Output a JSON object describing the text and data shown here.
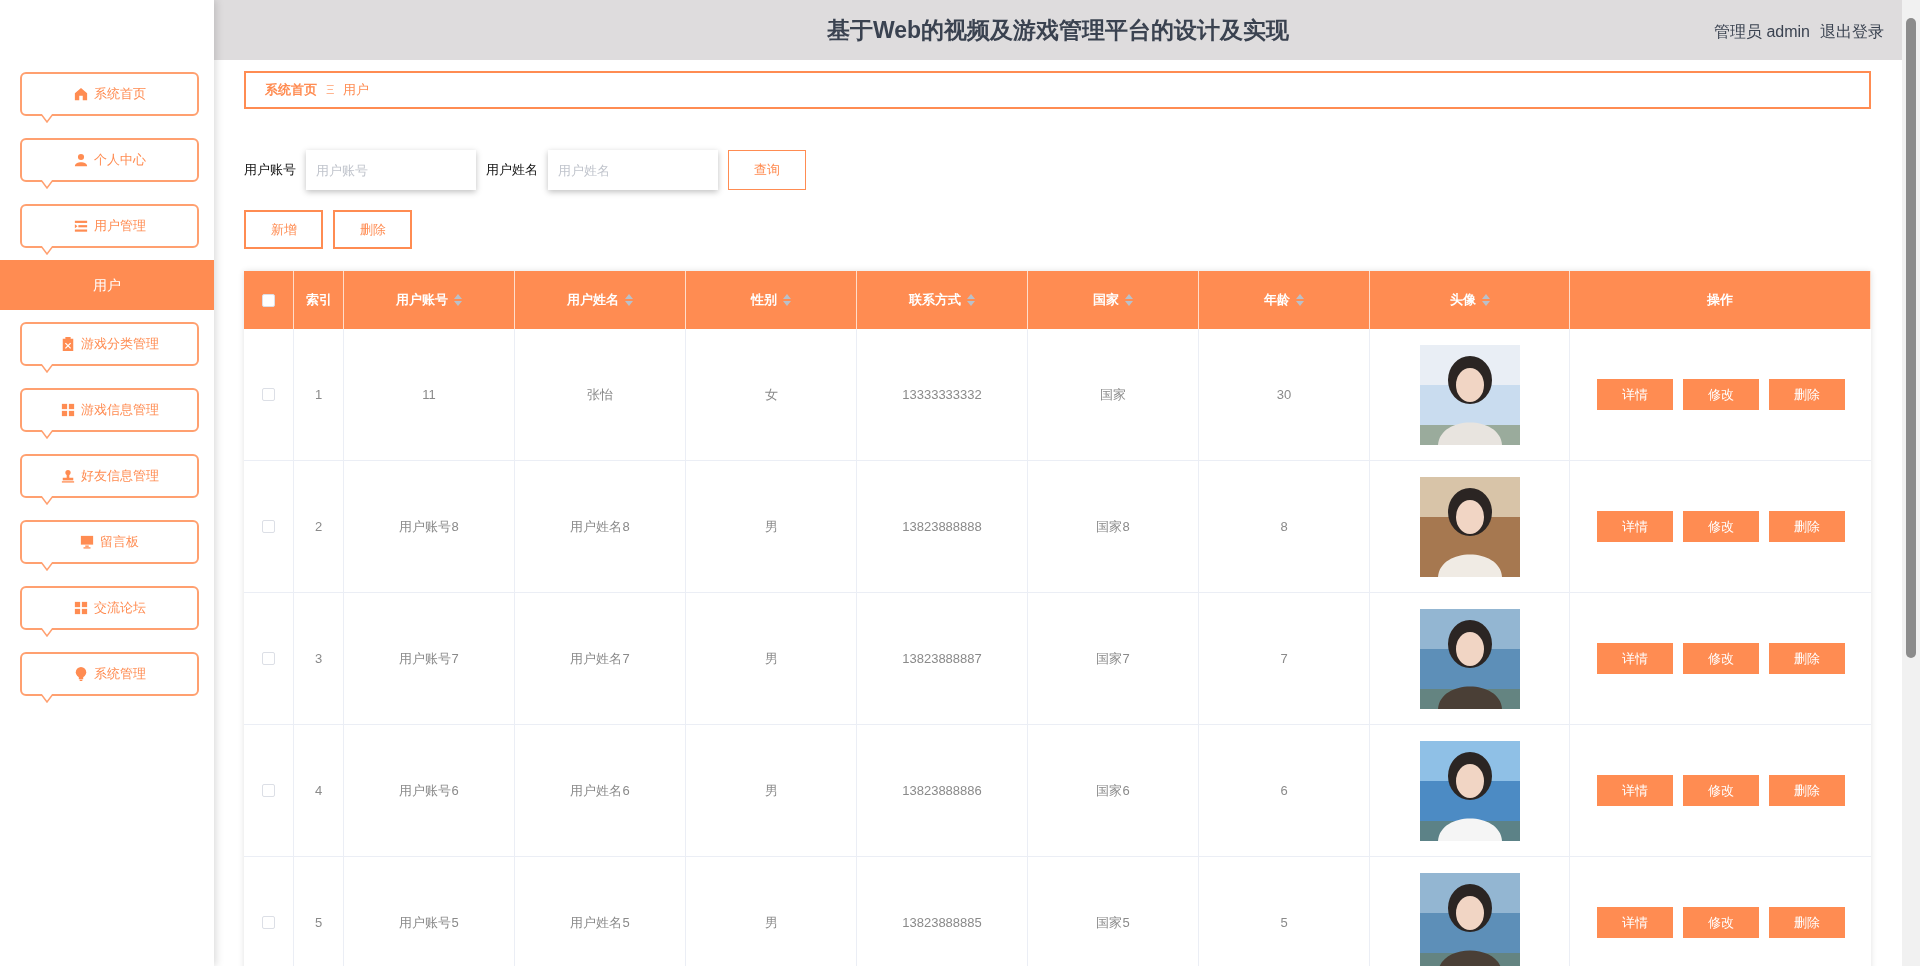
{
  "header": {
    "title": "基于Web的视频及游戏管理平台的设计及实现",
    "user": "管理员 admin",
    "logout": "退出登录"
  },
  "sidebar": {
    "items": [
      {
        "label": "系统首页",
        "selected": false
      },
      {
        "label": "个人中心",
        "selected": false
      },
      {
        "label": "用户管理",
        "selected": false,
        "children": [
          {
            "label": "用户",
            "selected": true
          }
        ]
      },
      {
        "label": "游戏分类管理",
        "selected": false
      },
      {
        "label": "游戏信息管理",
        "selected": false
      },
      {
        "label": "好友信息管理",
        "selected": false
      },
      {
        "label": "留言板",
        "selected": false
      },
      {
        "label": "交流论坛",
        "selected": false
      },
      {
        "label": "系统管理",
        "selected": false
      }
    ]
  },
  "breadcrumb": {
    "home": "系统首页",
    "separator": "Ξ",
    "current": "用户"
  },
  "search": {
    "fields": [
      {
        "label": "用户账号",
        "placeholder": "用户账号"
      },
      {
        "label": "用户姓名",
        "placeholder": "用户姓名"
      }
    ],
    "button": "查询"
  },
  "actions": [
    "新增",
    "删除"
  ],
  "table": {
    "columns": [
      {
        "label": "索引",
        "sortable": false
      },
      {
        "label": "用户账号",
        "sortable": true
      },
      {
        "label": "用户姓名",
        "sortable": true
      },
      {
        "label": "性别",
        "sortable": true
      },
      {
        "label": "联系方式",
        "sortable": true
      },
      {
        "label": "国家",
        "sortable": true
      },
      {
        "label": "年龄",
        "sortable": true
      },
      {
        "label": "头像",
        "sortable": true
      },
      {
        "label": "操作",
        "sortable": false
      }
    ],
    "all_checked": false,
    "rows": [
      {
        "checked": false,
        "cells": [
          "1",
          "11",
          "张怡",
          "女",
          "13333333332",
          "国家",
          "30"
        ],
        "buttons": [
          "详情",
          "修改",
          "删除"
        ]
      },
      {
        "checked": false,
        "cells": [
          "2",
          "用户账号8",
          "用户姓名8",
          "男",
          "13823888888",
          "国家8",
          "8"
        ],
        "buttons": [
          "详情",
          "修改",
          "删除"
        ]
      },
      {
        "checked": false,
        "cells": [
          "3",
          "用户账号7",
          "用户姓名7",
          "男",
          "13823888887",
          "国家7",
          "7"
        ],
        "buttons": [
          "详情",
          "修改",
          "删除"
        ]
      },
      {
        "checked": false,
        "cells": [
          "4",
          "用户账号6",
          "用户姓名6",
          "男",
          "13823888886",
          "国家6",
          "6"
        ],
        "buttons": [
          "详情",
          "修改",
          "删除"
        ]
      },
      {
        "checked": false,
        "cells": [
          "5",
          "用户账号5",
          "用户姓名5",
          "男",
          "13823888885",
          "国家5",
          "5"
        ],
        "buttons": [
          "详情",
          "修改",
          "删除"
        ]
      }
    ]
  }
}
